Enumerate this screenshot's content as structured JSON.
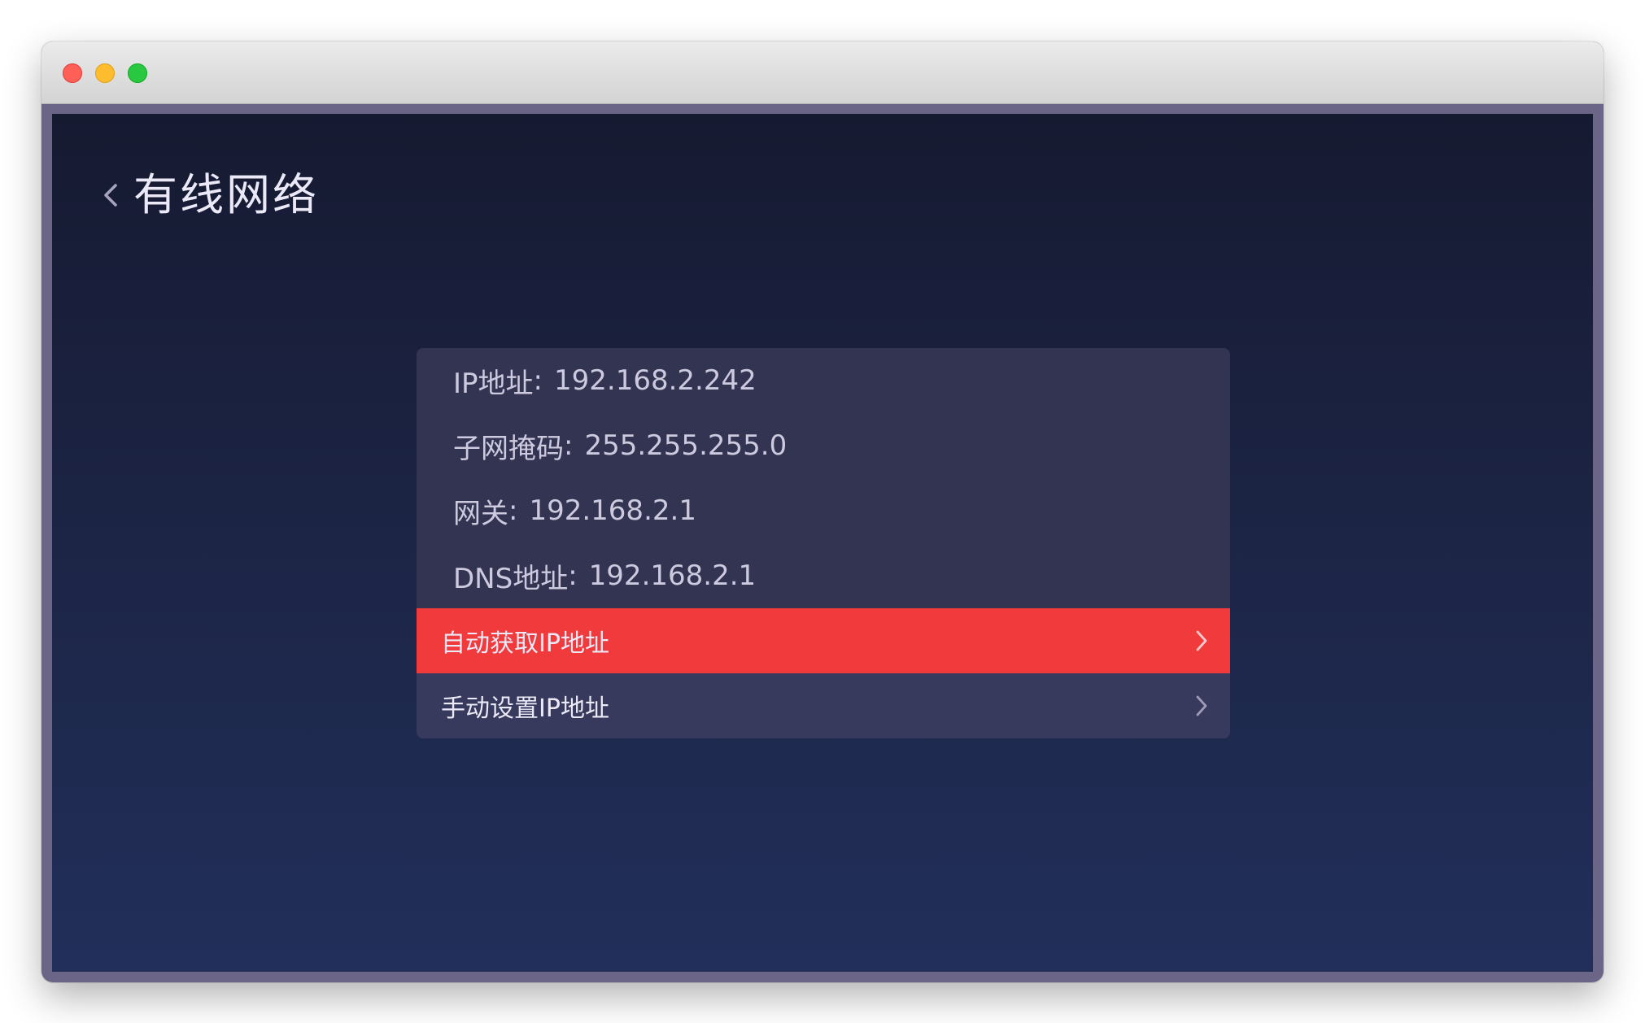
{
  "window": {
    "title_bar_buttons": [
      "close",
      "minimize",
      "zoom"
    ]
  },
  "header": {
    "back_icon": "chevron-left-icon",
    "title": "有线网络"
  },
  "network_info": [
    {
      "label": "IP地址",
      "separator": ":",
      "value": "192.168.2.242"
    },
    {
      "label": "子网掩码",
      "separator": ":",
      "value": "255.255.255.0"
    },
    {
      "label": "网关",
      "separator": ":",
      "value": "192.168.2.1"
    },
    {
      "label": "DNS地址",
      "separator": ":",
      "value": "192.168.2.1"
    }
  ],
  "options": [
    {
      "label": "自动获取IP地址",
      "selected": true,
      "icon": "chevron-right-icon"
    },
    {
      "label": "手动设置IP地址",
      "selected": false,
      "icon": "chevron-right-icon"
    }
  ],
  "colors": {
    "highlight": "#f03a3c",
    "panel": "#323452",
    "background_top": "#161a31",
    "background_bottom": "#212f5a"
  }
}
